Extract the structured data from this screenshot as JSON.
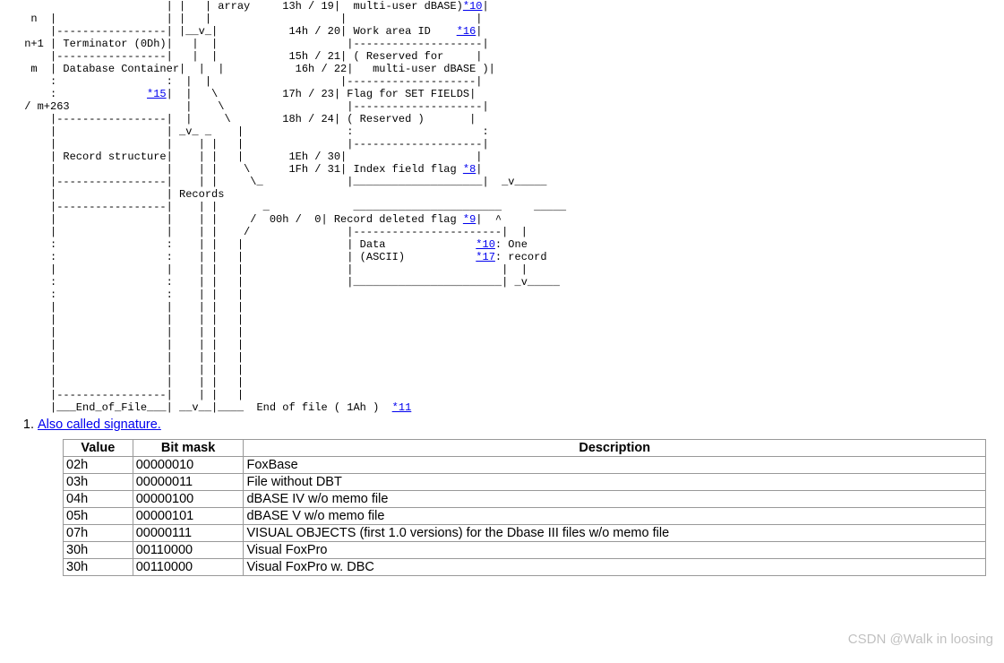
{
  "diagram_lines": [
    {
      "segments": [
        {
          "t": "                       | |   | array     13h / 19|  multi-user dBASE)"
        },
        {
          "t": "*10",
          "link": true
        },
        {
          "t": "|"
        }
      ]
    },
    {
      "segments": [
        {
          "t": "  n  |                 | |   |                    |                    |"
        }
      ]
    },
    {
      "segments": [
        {
          "t": "     |-----------------| |__v_|           14h / 20| Work area ID    "
        },
        {
          "t": "*16",
          "link": true
        },
        {
          "t": "|"
        }
      ]
    },
    {
      "segments": [
        {
          "t": " n+1 | Terminator (0Dh)|   |  |                    |--------------------|"
        }
      ]
    },
    {
      "segments": [
        {
          "t": "     |-----------------|   |  |           15h / 21| ( Reserved for     |"
        }
      ]
    },
    {
      "segments": [
        {
          "t": "  m  | Database Container|  |  |           16h / 22|   multi-user dBASE )|"
        }
      ]
    },
    {
      "segments": [
        {
          "t": "     :                 :  |  |                    |--------------------|"
        }
      ]
    },
    {
      "segments": [
        {
          "t": "     :              "
        },
        {
          "t": "*15",
          "link": true
        },
        {
          "t": "|  |   \\          17h / 23| Flag for SET FIELDS|"
        }
      ]
    },
    {
      "segments": [
        {
          "t": " / m+263                  |    \\                   |--------------------|"
        }
      ]
    },
    {
      "segments": [
        {
          "t": "     |-----------------|  |     \\        18h / 24| ( Reserved )       |"
        }
      ]
    },
    {
      "segments": [
        {
          "t": "     |                 | _v_ _    |                :                    :"
        }
      ]
    },
    {
      "segments": [
        {
          "t": "     |                 |    | |   |                |--------------------|"
        }
      ]
    },
    {
      "segments": [
        {
          "t": "     | Record structure|    | |   |       1Eh / 30|                    |"
        }
      ]
    },
    {
      "segments": [
        {
          "t": "     |                 |    | |    \\      1Fh / 31| Index field flag "
        },
        {
          "t": "*8",
          "link": true
        },
        {
          "t": "|"
        }
      ]
    },
    {
      "segments": [
        {
          "t": "     |-----------------|    | |     \\_             |____________________|  _v_____"
        }
      ]
    },
    {
      "segments": [
        {
          "t": "     |                 | Records                                                 "
        }
      ]
    },
    {
      "segments": [
        {
          "t": "     |-----------------|    | |       _             _______________________     _____"
        }
      ]
    },
    {
      "segments": [
        {
          "t": "     |                 |    | |     /  00h /  0| Record deleted flag "
        },
        {
          "t": "*9",
          "link": true
        },
        {
          "t": "|  ^"
        }
      ]
    },
    {
      "segments": [
        {
          "t": "     |                 |    | |    /               |-----------------------|  |"
        }
      ]
    },
    {
      "segments": [
        {
          "t": "     :                 :    | |   |                | Data              "
        },
        {
          "t": "*10",
          "link": true
        },
        {
          "t": ": One"
        }
      ]
    },
    {
      "segments": [
        {
          "t": "     :                 :    | |   |                | (ASCII)           "
        },
        {
          "t": "*17",
          "link": true
        },
        {
          "t": ": record"
        }
      ]
    },
    {
      "segments": [
        {
          "t": "     |                 |    | |   |                |                       |  |"
        }
      ]
    },
    {
      "segments": [
        {
          "t": "     :                 :    | |   |                |_______________________| _v_____"
        }
      ]
    },
    {
      "segments": [
        {
          "t": "     :                 :    | |   |"
        }
      ]
    },
    {
      "segments": [
        {
          "t": "     |                 |    | |   |"
        }
      ]
    },
    {
      "segments": [
        {
          "t": "     |                 |    | |   |"
        }
      ]
    },
    {
      "segments": [
        {
          "t": "     |                 |    | |   |"
        }
      ]
    },
    {
      "segments": [
        {
          "t": "     |                 |    | |   |"
        }
      ]
    },
    {
      "segments": [
        {
          "t": "     |                 |    | |   |"
        }
      ]
    },
    {
      "segments": [
        {
          "t": "     |                 |    | |   |"
        }
      ]
    },
    {
      "segments": [
        {
          "t": "     |                 |    | |   |"
        }
      ]
    },
    {
      "segments": [
        {
          "t": "     |-----------------|    | |   |"
        }
      ]
    },
    {
      "segments": [
        {
          "t": "     |___End_of_File___| __v__|____  End of file ( 1Ah )  "
        },
        {
          "t": "*11",
          "link": true
        }
      ]
    }
  ],
  "list_item": {
    "number": "1.",
    "text": "Also called signature."
  },
  "table": {
    "headers": [
      "Value",
      "Bit mask",
      "Description"
    ],
    "rows": [
      {
        "value": "02h",
        "mask": "00000010",
        "desc": "FoxBase"
      },
      {
        "value": "03h",
        "mask": "00000011",
        "desc": "File without DBT"
      },
      {
        "value": "04h",
        "mask": "00000100",
        "desc": "dBASE IV w/o memo file"
      },
      {
        "value": "05h",
        "mask": "00000101",
        "desc": "dBASE V w/o memo file"
      },
      {
        "value": "07h",
        "mask": "00000111",
        "desc": "VISUAL OBJECTS (first 1.0 versions) for the Dbase III files w/o memo file"
      },
      {
        "value": "30h",
        "mask": "00110000",
        "desc": "Visual FoxPro"
      },
      {
        "value": "30h",
        "mask": "00110000",
        "desc": "Visual FoxPro w. DBC"
      }
    ]
  },
  "watermark": "CSDN @Walk in loosing"
}
